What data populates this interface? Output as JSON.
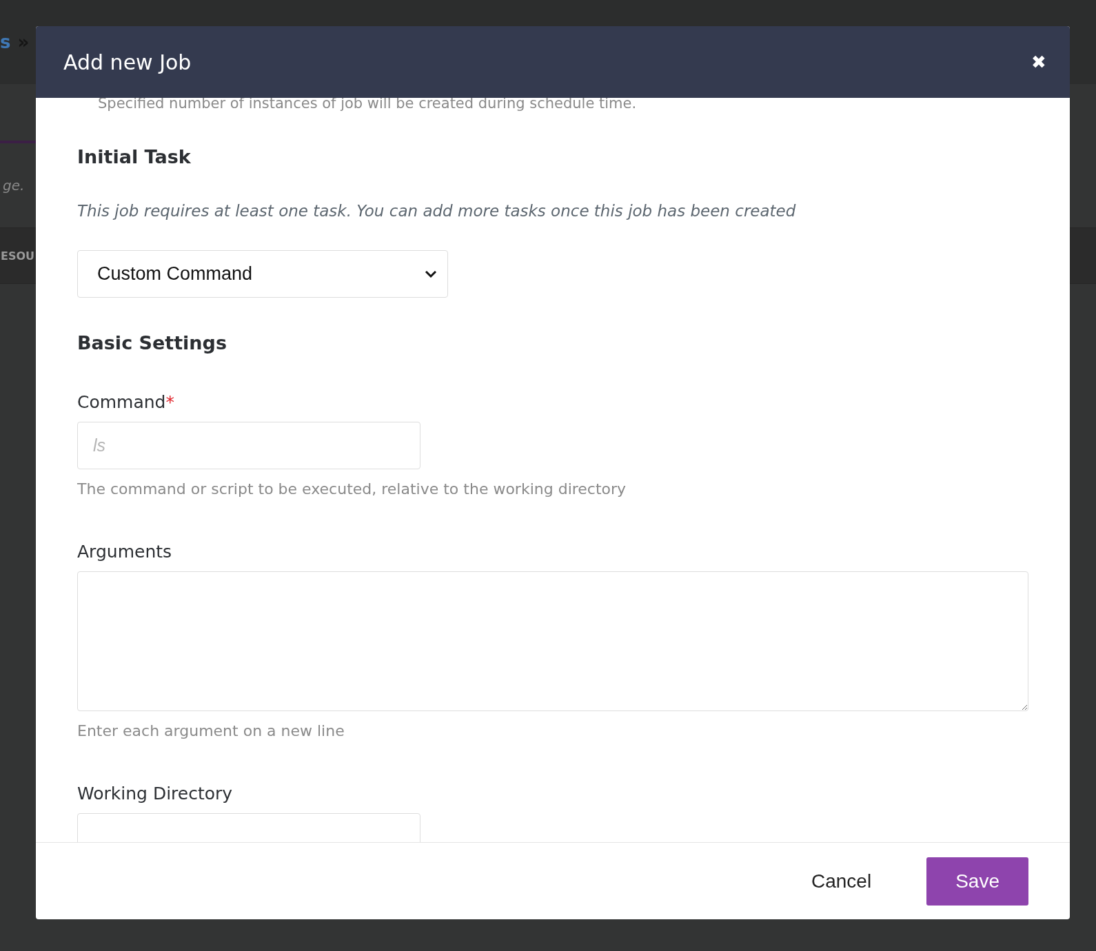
{
  "background": {
    "breadcrumb": [
      "s",
      "»"
    ],
    "note": "ge.",
    "section": "ESOU"
  },
  "modal": {
    "title": "Add new Job",
    "close": "✖",
    "required_mark": "*",
    "intro_hint": "Specified number of instances of job will be created during schedule time.",
    "sections": [
      {
        "kind": "task",
        "heading": "Initial Task",
        "note": "This job requires at least one task. You can add more tasks once this job has been created",
        "select_value": "Custom Command"
      },
      {
        "kind": "settings",
        "heading": "Basic Settings",
        "fields": [
          {
            "kind": "input",
            "label": "Command",
            "required": true,
            "placeholder": "ls",
            "help": "The command or script to be executed, relative to the working directory"
          },
          {
            "kind": "textarea",
            "label": "Arguments",
            "required": false,
            "help": "Enter each argument on a new line"
          },
          {
            "kind": "input",
            "label": "Working Directory",
            "required": false
          }
        ]
      }
    ],
    "buttons": [
      {
        "kind": "secondary",
        "label": "Cancel"
      },
      {
        "kind": "primary",
        "label": "Save"
      }
    ]
  }
}
